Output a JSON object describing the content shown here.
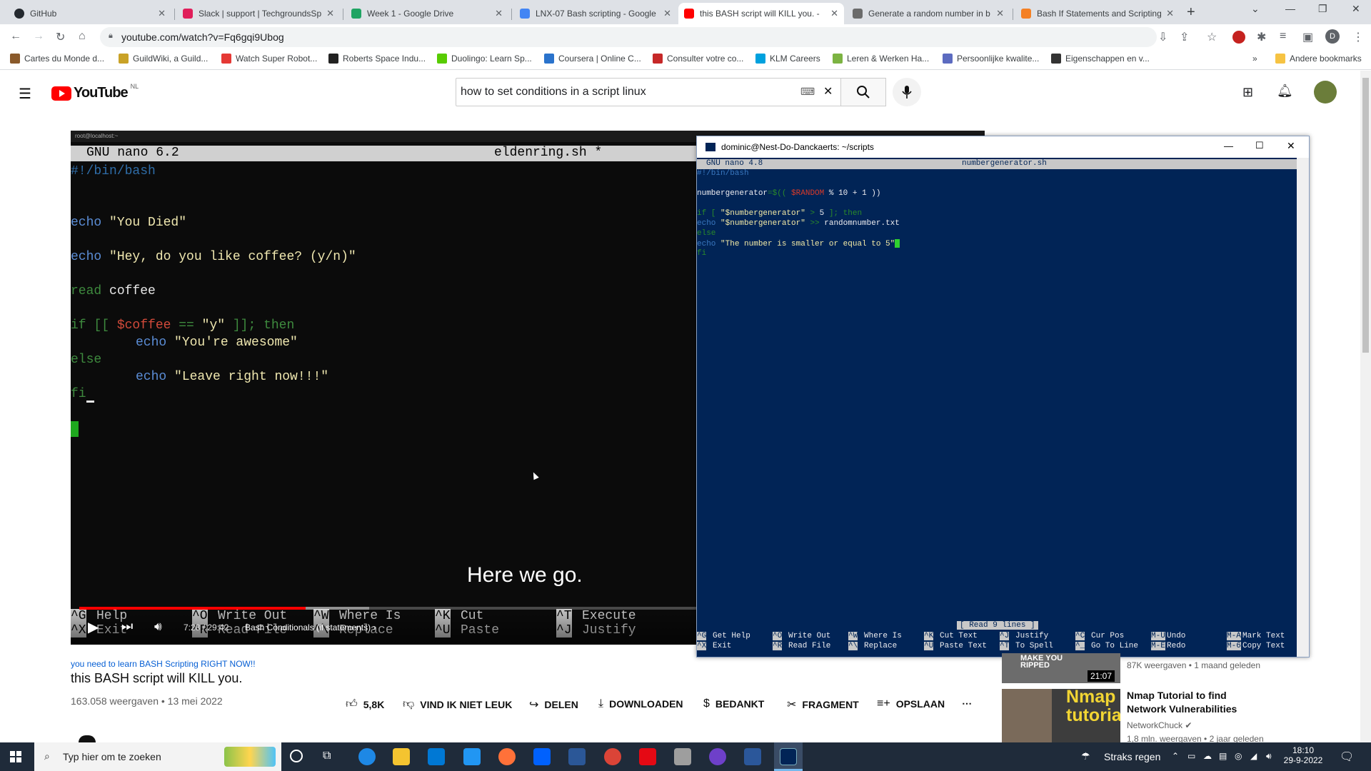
{
  "tabs": [
    {
      "title": "GitHub",
      "color": "#24292f"
    },
    {
      "title": "Slack | support | TechgroundsSp",
      "color": "#e01e5a"
    },
    {
      "title": "Week 1 - Google Drive",
      "color": "#1fa463"
    },
    {
      "title": "LNX-07 Bash scripting - Google",
      "color": "#4285f4"
    },
    {
      "title": "this BASH script will KILL you. -",
      "color": "#ff0000"
    },
    {
      "title": "Generate a random number in b",
      "color": "#6b6b6b"
    },
    {
      "title": "Bash If Statements and Scripting",
      "color": "#f48024"
    }
  ],
  "address": "youtube.com/watch?v=Fq6gqi9Ubog",
  "bookmarks": [
    "Cartes du Monde d...",
    "GuildWiki, a Guild...",
    "Watch Super Robot...",
    "Roberts Space Indu...",
    "Duolingo: Learn Sp...",
    "Coursera | Online C...",
    "Consulter votre co...",
    "KLM Careers",
    "Leren & Werken Ha...",
    "Persoonlijke kwalite...",
    "Eigenschappen en v..."
  ],
  "bookmarks_other": "Andere bookmarks",
  "youtube": {
    "logo": "YouTube",
    "region": "NL",
    "search_value": "how to set conditions in a script linux"
  },
  "video": {
    "window_label": "root@localhost:~",
    "nano_version": "GNU nano 6.2",
    "filename": "eldenring.sh *",
    "lines": {
      "l1": "#!/bin/bash",
      "l2a": "echo",
      "l2b": " \"You Died\"",
      "l3a": "echo",
      "l3b": " \"Hey, do you like coffee? (y/n)\"",
      "l4a": "read",
      "l4b": " coffee",
      "l5a": "if [[ ",
      "l5b": "$coffee",
      "l5c": " == ",
      "l5d": "\"y\"",
      "l5e": " ]]; then",
      "l6a": "echo",
      "l6b": " \"You're awesome\"",
      "l7": "else",
      "l8a": "echo",
      "l8b": " \"Leave right now!!!\"",
      "l9": "fi"
    },
    "shortcuts": [
      [
        "^G",
        "Help",
        "^X",
        "Exit"
      ],
      [
        "^O",
        "Write Out",
        "^R",
        "Read File"
      ],
      [
        "^W",
        "Where Is",
        "^\\",
        "Replace"
      ],
      [
        "^K",
        "Cut",
        "^U",
        "Paste"
      ],
      [
        "^T",
        "Execute",
        "^J",
        "Justify"
      ]
    ],
    "subtitle": "Here we go.",
    "time": "7:28 / 29:42",
    "chapter": "Bash Conditionals (if statements)",
    "progress_fraction": 0.252
  },
  "terminal": {
    "title": "dominic@Nest-Do-Danckaerts: ~/scripts",
    "nano_version": "GNU nano 4.8",
    "filename": "numbergenerator.sh",
    "line1": "#!/bin/bash",
    "line2a": "numbergenerator",
    "line2b": "=$(( ",
    "line2c": "$RANDOM",
    "line2d": " % 10 + 1 ))",
    "line3a": "if [ ",
    "line3b": "\"$numbergenerator\"",
    "line3c": " > ",
    "line3d": "5",
    "line3e": " ]; then",
    "line4a": "echo ",
    "line4b": "\"$numbergenerator\"",
    "line4c": " >> ",
    "line4d": "randomnumber.txt",
    "line5": "else",
    "line6a": "echo ",
    "line6b": "\"The number is smaller or equal to 5\"",
    "line7": "fi",
    "status": "[ Read 9 lines ]",
    "shortcuts": [
      [
        "^G",
        "Get Help",
        "^X",
        "Exit"
      ],
      [
        "^O",
        "Write Out",
        "^R",
        "Read File"
      ],
      [
        "^W",
        "Where Is",
        "^\\",
        "Replace"
      ],
      [
        "^K",
        "Cut Text",
        "^U",
        "Paste Text"
      ],
      [
        "^J",
        "Justify",
        "^T",
        "To Spell"
      ],
      [
        "^C",
        "Cur Pos",
        "^_",
        "Go To Line"
      ],
      [
        "M-U",
        "Undo",
        "M-E",
        "Redo"
      ],
      [
        "M-A",
        "Mark Text",
        "M-6",
        "Copy Text"
      ]
    ]
  },
  "below_video": {
    "hashtag_line": "you need to learn BASH Scripting RIGHT NOW!!",
    "title": "this BASH script will KILL you.",
    "meta": "163.058 weergaven • 13 mei 2022",
    "likes": "5,8K",
    "dislike": "VIND IK NIET LEUK",
    "share": "DELEN",
    "download": "DOWNLOADEN",
    "thanks": "BEDANKT",
    "clip": "FRAGMENT",
    "save": "OPSLAAN"
  },
  "sidebar": {
    "item1_meta": "87K weergaven • 1 maand geleden",
    "item1_duration": "21:07",
    "item1_thumb_text": "MAKE YOU RIPPED",
    "item2_title": "Nmap Tutorial to find Network Vulnerabilities",
    "item2_channel": "NetworkChuck",
    "item2_meta": "1,8 mln. weergaven • 2 jaar geleden",
    "item2_thumb_text": "Nmap tutorial"
  },
  "taskbar": {
    "search_placeholder": "Typ hier om te zoeken",
    "weather": "Straks regen",
    "time": "18:10",
    "date": "29-9-2022"
  }
}
